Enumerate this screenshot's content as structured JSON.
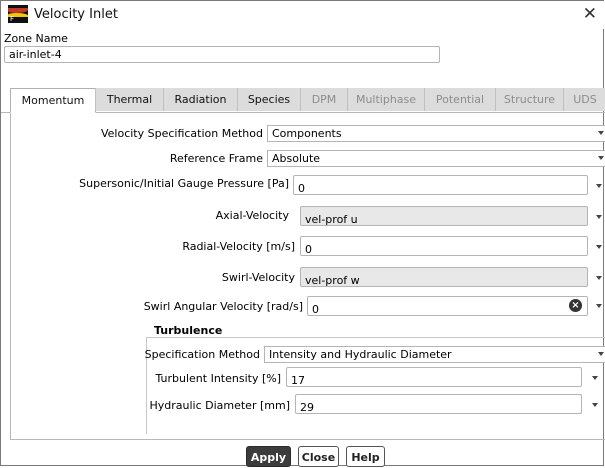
{
  "window": {
    "title": "Velocity Inlet",
    "close_glyph": "✕"
  },
  "zone": {
    "label": "Zone Name",
    "value": "air-inlet-4"
  },
  "tabs": [
    {
      "label": "Momentum",
      "state": "active"
    },
    {
      "label": "Thermal",
      "state": "enabled"
    },
    {
      "label": "Radiation",
      "state": "enabled"
    },
    {
      "label": "Species",
      "state": "enabled"
    },
    {
      "label": "DPM",
      "state": "disabled"
    },
    {
      "label": "Multiphase",
      "state": "disabled"
    },
    {
      "label": "Potential",
      "state": "disabled"
    },
    {
      "label": "Structure",
      "state": "disabled"
    },
    {
      "label": "UDS",
      "state": "disabled"
    }
  ],
  "momentum": {
    "velocity_spec_method": {
      "label": "Velocity Specification Method",
      "value": "Components"
    },
    "reference_frame": {
      "label": "Reference Frame",
      "value": "Absolute"
    },
    "gauge_pressure": {
      "label": "Supersonic/Initial Gauge Pressure [Pa]",
      "value": "0"
    },
    "axial_velocity": {
      "label": "Axial-Velocity",
      "value": "vel-prof u"
    },
    "radial_velocity": {
      "label": "Radial-Velocity [m/s]",
      "value": "0"
    },
    "swirl_velocity": {
      "label": "Swirl-Velocity",
      "value": "vel-prof w"
    },
    "swirl_angular_velocity": {
      "label": "Swirl Angular Velocity [rad/s]",
      "value": "0"
    }
  },
  "turbulence": {
    "title": "Turbulence",
    "spec_method": {
      "label": "Specification Method",
      "value": "Intensity and Hydraulic Diameter"
    },
    "intensity": {
      "label": "Turbulent Intensity [%]",
      "value": "17"
    },
    "hydraulic_diameter": {
      "label": "Hydraulic Diameter [mm]",
      "value": "29"
    }
  },
  "buttons": {
    "apply": "Apply",
    "close": "Close",
    "help": "Help"
  },
  "colors": {
    "primary_button": "#3c3c3c",
    "disabled_tab_text": "#8c8c8c",
    "readonly_field": "#e8e8e8"
  },
  "icons": [
    "fluent-app-icon",
    "close-icon",
    "dropdown-caret-icon",
    "clear-icon"
  ]
}
